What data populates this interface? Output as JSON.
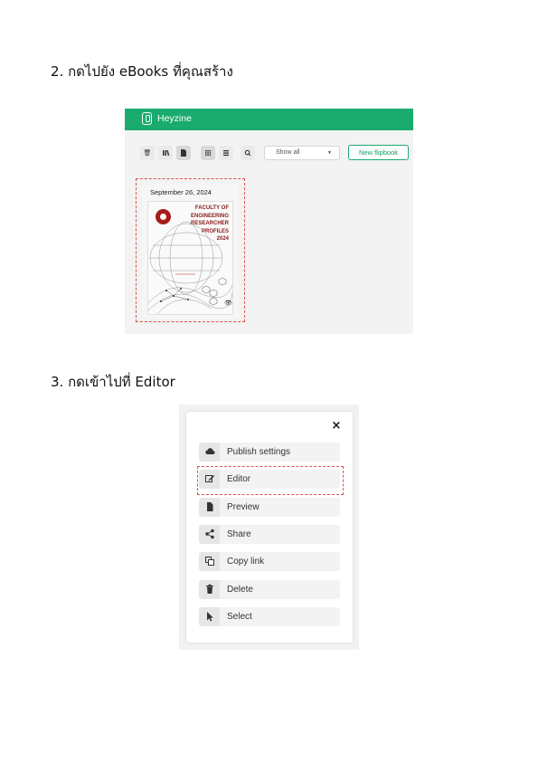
{
  "steps": {
    "step2": "2. กดไปยัง eBooks ที่คุณสร้าง",
    "step3": "3. กดเข้าไปที่ Editor"
  },
  "screenshot1": {
    "brand": "Heyzine",
    "brand_color": "#1aab6e",
    "toolbar_icons": [
      "trash-icon",
      "library-icon",
      "document-icon",
      "grid-icon",
      "list-icon",
      "search-icon"
    ],
    "filter": {
      "selected": "Show all"
    },
    "new_button": "New flipbook",
    "card": {
      "date": "September 26, 2024",
      "cover_title": "FACULTY OF ENGINEERING RESEARCHER PROFILES 2024",
      "cover_title_lines": [
        "FACULTY OF",
        "ENGINEERING",
        "RESEARCHER",
        "PROFILES",
        "2024"
      ]
    }
  },
  "screenshot2": {
    "close": "×",
    "items": [
      {
        "label": "Publish settings",
        "icon": "cloud-icon"
      },
      {
        "label": "Editor",
        "icon": "edit-icon"
      },
      {
        "label": "Preview",
        "icon": "document-icon"
      },
      {
        "label": "Share",
        "icon": "share-icon"
      },
      {
        "label": "Copy link",
        "icon": "copy-icon"
      },
      {
        "label": "Delete",
        "icon": "trash-icon"
      },
      {
        "label": "Select",
        "icon": "cursor-icon"
      }
    ]
  },
  "highlight_color": "#e05050"
}
